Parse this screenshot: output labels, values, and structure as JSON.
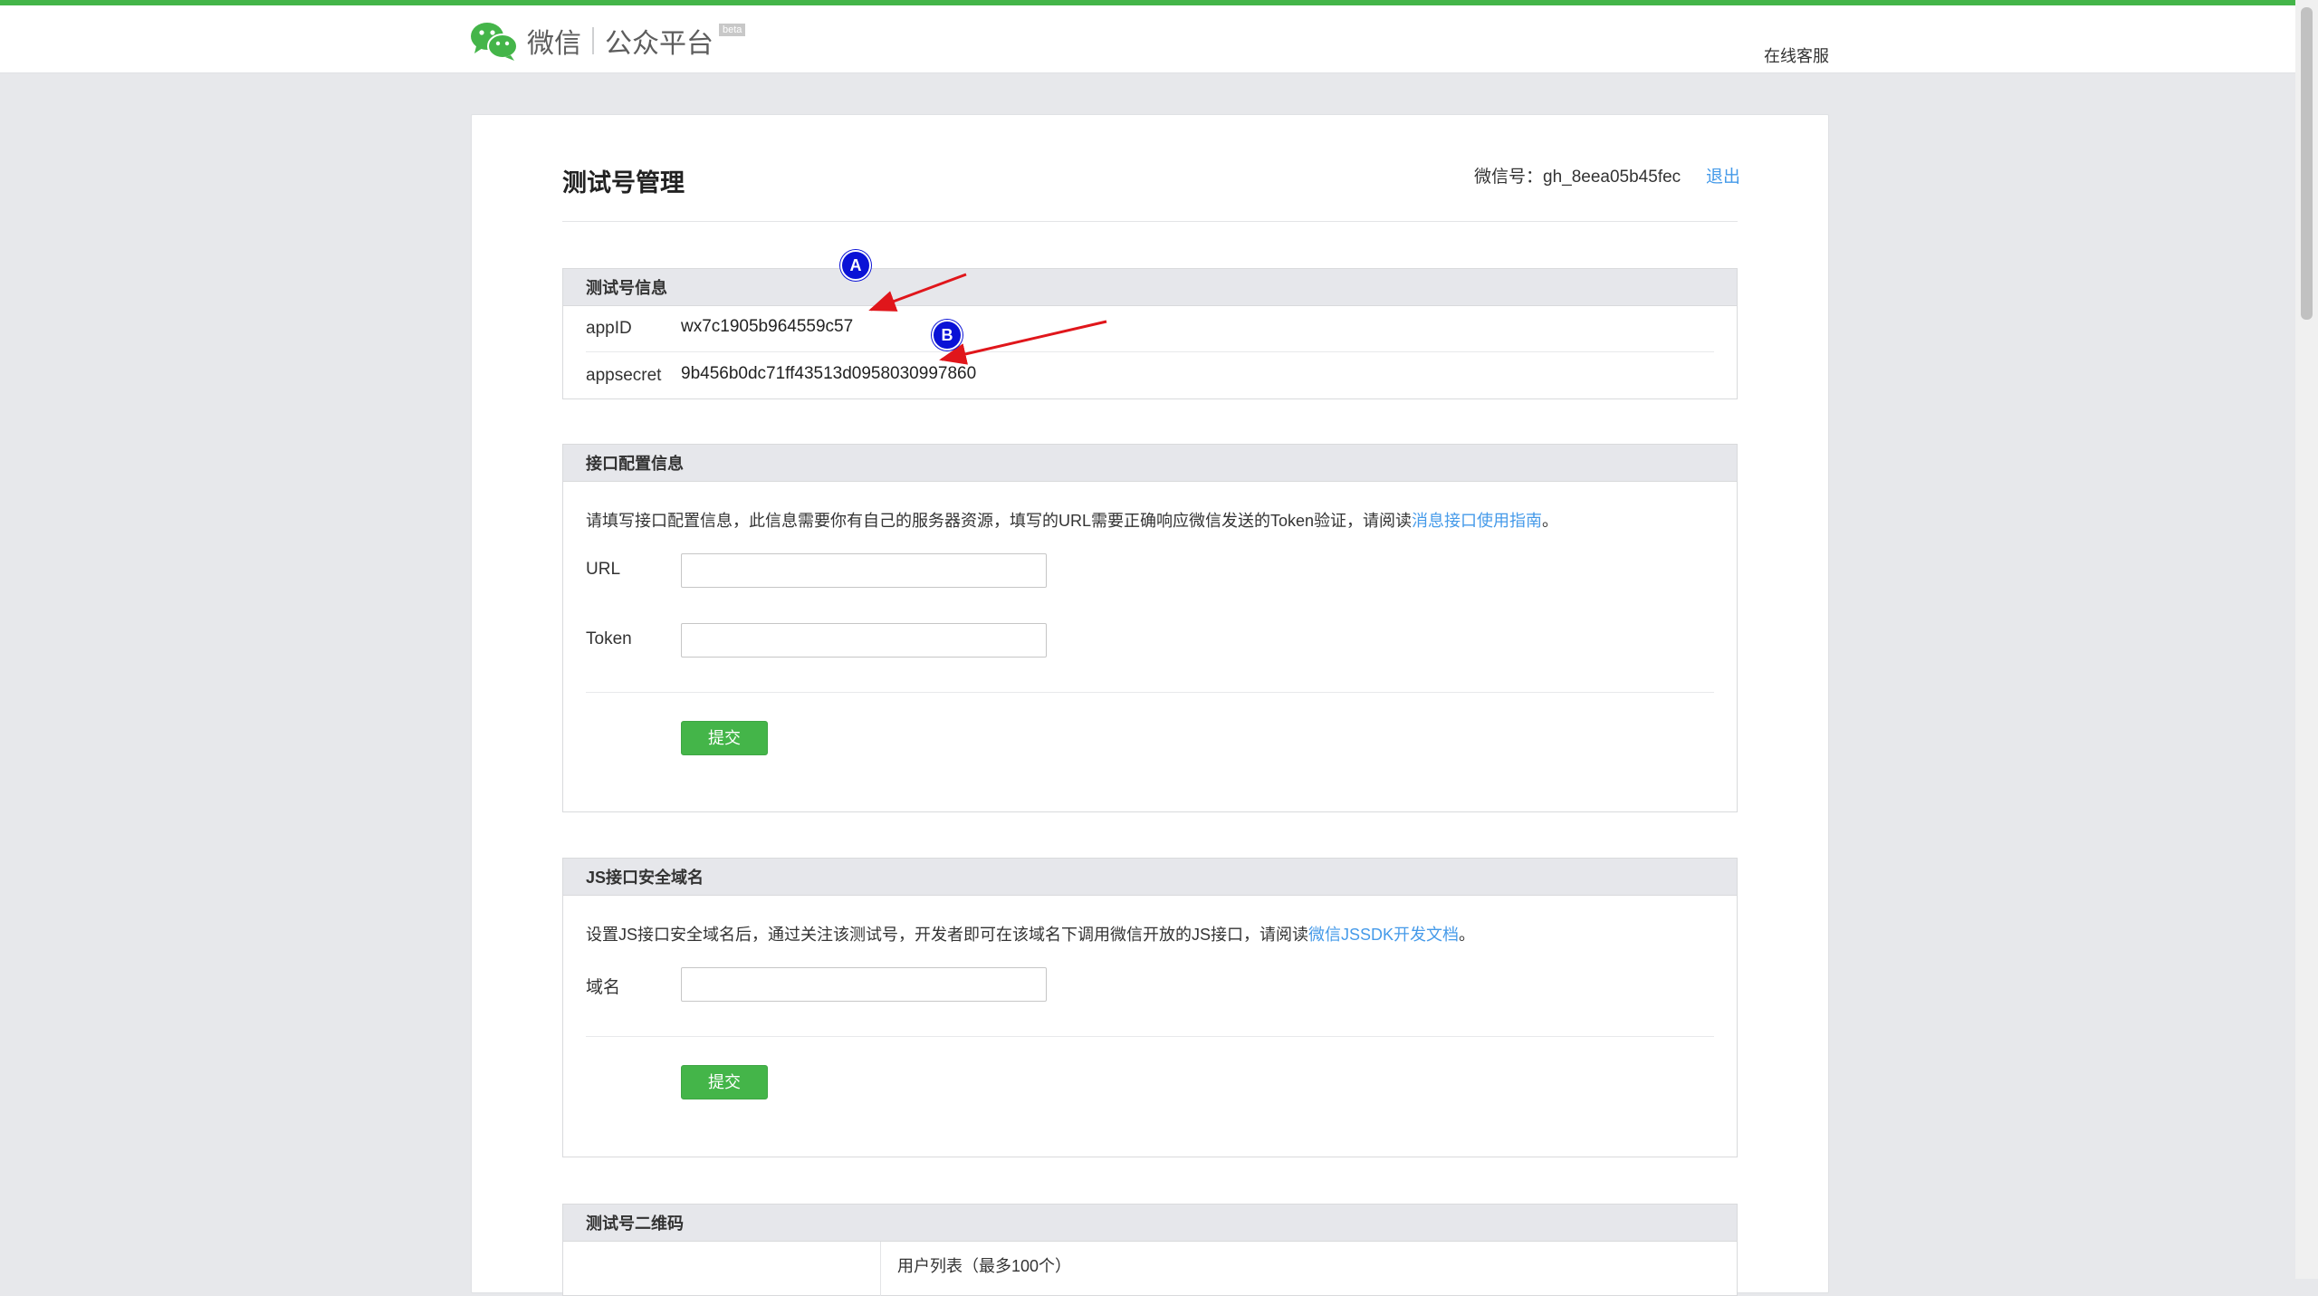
{
  "header": {
    "logo_text": "微信",
    "platform_text": "公众平台",
    "beta_label": "beta",
    "service_link": "在线客服"
  },
  "page": {
    "title": "测试号管理",
    "account_label": "微信号：",
    "account_value": "gh_8eea05b45fec",
    "logout_label": "退出"
  },
  "test_info": {
    "heading": "测试号信息",
    "appid_label": "appID",
    "appid_value": "wx7c1905b964559c57",
    "appsecret_label": "appsecret",
    "appsecret_value": "9b456b0dc71ff43513d0958030997860"
  },
  "annotations": {
    "a": "A",
    "b": "B"
  },
  "interface_config": {
    "heading": "接口配置信息",
    "desc_prefix": "请填写接口配置信息，此信息需要你有自己的服务器资源，填写的URL需要正确响应微信发送的Token验证，请阅读",
    "desc_link": "消息接口使用指南",
    "desc_suffix": "。",
    "url_label": "URL",
    "url_value": "",
    "token_label": "Token",
    "token_value": "",
    "submit_label": "提交"
  },
  "js_domain": {
    "heading": "JS接口安全域名",
    "desc_prefix": "设置JS接口安全域名后，通过关注该测试号，开发者即可在该域名下调用微信开放的JS接口，请阅读",
    "desc_link": "微信JSSDK开发文档",
    "desc_suffix": "。",
    "domain_label": "域名",
    "domain_value": "",
    "submit_label": "提交"
  },
  "qrcode": {
    "heading": "测试号二维码",
    "user_list_label": "用户列表（最多100个）"
  },
  "colors": {
    "brand_green": "#44b549",
    "link_blue": "#459ae9",
    "annotation_blue": "#0a12d6",
    "annotation_arrow": "#e0161b"
  }
}
